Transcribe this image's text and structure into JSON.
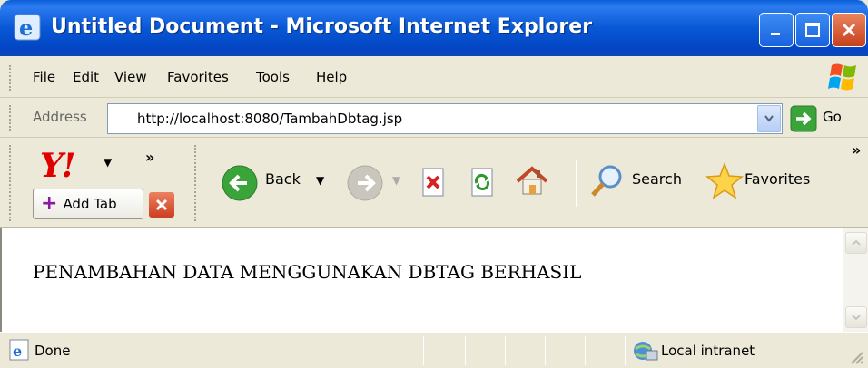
{
  "window": {
    "title": "Untitled Document - Microsoft Internet Explorer",
    "icon": "ie-icon"
  },
  "menu": {
    "items": [
      {
        "label": "File",
        "underline_char": "F"
      },
      {
        "label": "Edit",
        "underline_char": "E"
      },
      {
        "label": "View",
        "underline_char": "V"
      },
      {
        "label": "Favorites",
        "underline_char": "a"
      },
      {
        "label": "Tools",
        "underline_char": "T"
      },
      {
        "label": "Help",
        "underline_char": "H"
      }
    ]
  },
  "address": {
    "label": "Address",
    "url": "http://localhost:8080/TambahDbtag.jsp",
    "go_label": "Go"
  },
  "toolbar": {
    "yahoo_logo": "Y!",
    "add_tab_label": "Add Tab",
    "back_label": "Back",
    "search_label": "Search",
    "favorites_label": "Favorites",
    "chevron": "»"
  },
  "page": {
    "message": "PENAMBAHAN DATA MENGGUNAKAN DBTAG BERHASIL"
  },
  "status": {
    "text": "Done",
    "zone": "Local intranet"
  },
  "colors": {
    "titlebar": "#0858d6",
    "chrome": "#ece9d8",
    "yahoo_red": "#e00000"
  }
}
